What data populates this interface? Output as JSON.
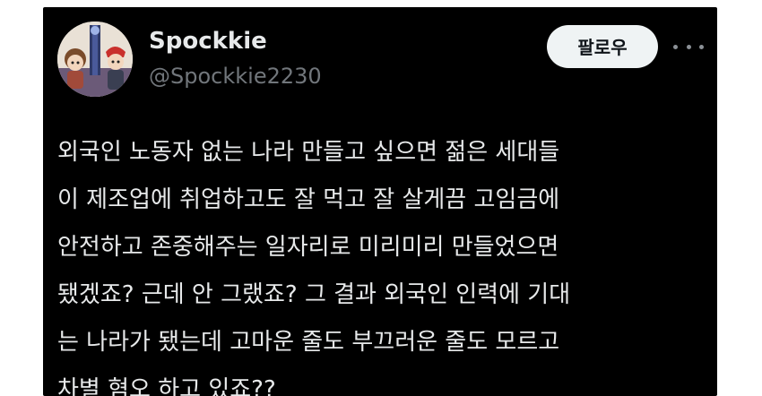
{
  "tweet": {
    "avatar_icon": "profile-avatar",
    "display_name": "Spockkie",
    "handle": "@Spockkie2230",
    "follow_label": "팔로우",
    "more_icon": "more-options-icon",
    "text_lines": [
      "외국인 노동자 없는 나라 만들고 싶으면 젊은 세대들",
      "이 제조업에 취업하고도 잘 먹고 잘 살게끔 고임금에",
      "안전하고 존중해주는 일자리로 미리미리 만들었으면",
      "됐겠죠? 근데 안 그랬죠? 그 결과 외국인 인력에 기대",
      "는 나라가 됐는데 고마운 줄도 부끄러운 줄도 모르고",
      "차별 혐오 하고 있죠??"
    ]
  },
  "colors": {
    "background": "#000000",
    "primary_text": "#e7e9ea",
    "secondary_text": "#71767b",
    "follow_button_bg": "#eff3f4",
    "follow_button_text": "#0f1419"
  }
}
